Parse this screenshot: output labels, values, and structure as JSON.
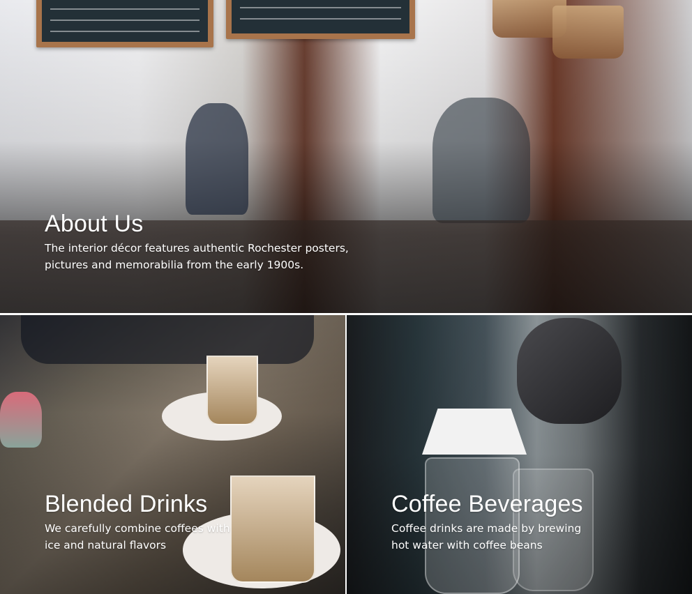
{
  "about": {
    "title": "About Us",
    "description": "The interior décor features authentic Rochester posters, pictures and memorabilia from the early 1900s."
  },
  "blended": {
    "title": "Blended Drinks",
    "description": "We carefully combine coffees with ice and natural flavors"
  },
  "coffee": {
    "title": "Coffee Beverages",
    "description": "Coffee drinks are made by brewing hot water with coffee beans"
  }
}
